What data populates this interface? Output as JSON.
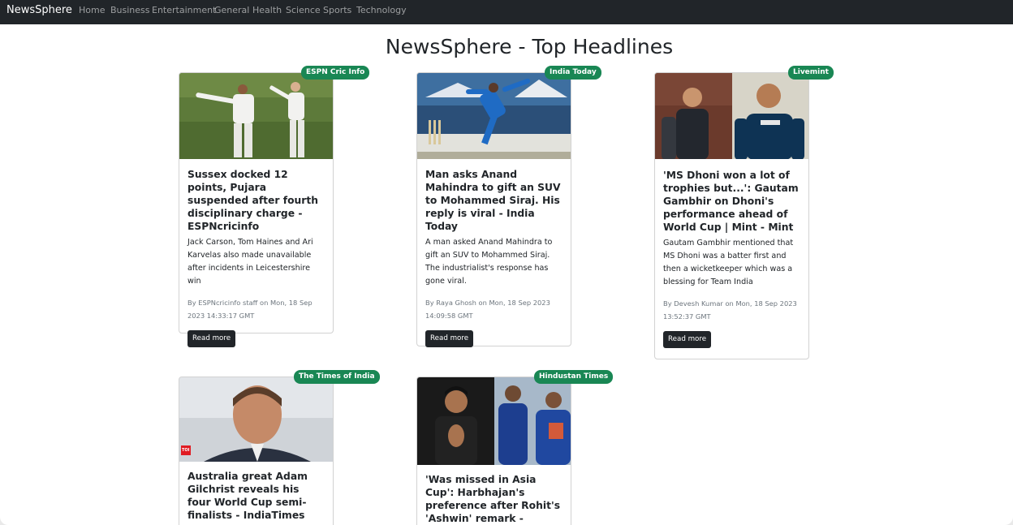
{
  "navbar": {
    "brand": "NewsSphere",
    "links": [
      "Home",
      "Business",
      "Entertainment",
      "General",
      "Health",
      "Science",
      "Sports",
      "Technology"
    ]
  },
  "page": {
    "title": "NewsSphere - Top Headlines"
  },
  "articles": [
    {
      "source": "ESPN Cric Info",
      "title": "Sussex docked 12 points, Pujara suspended after fourth disciplinary charge - ESPNcricinfo",
      "description": "Jack Carson, Tom Haines and Ari Karvelas also made unavailable after incidents in Leicestershire win",
      "meta": "By ESPNcricinfo staff on Mon, 18 Sep 2023 14:33:17 GMT",
      "read_more": "Read more"
    },
    {
      "source": "India Today",
      "title": "Man asks Anand Mahindra to gift an SUV to Mohammed Siraj. His reply is viral - India Today",
      "description": "A man asked Anand Mahindra to gift an SUV to Mohammed Siraj. The industrialist's response has gone viral.",
      "meta": "By Raya Ghosh on Mon, 18 Sep 2023 14:09:58 GMT",
      "read_more": "Read more"
    },
    {
      "source": "Livemint",
      "title": "'MS Dhoni won a lot of trophies but...': Gautam Gambhir on Dhoni's performance ahead of World Cup | Mint - Mint",
      "description": "Gautam Gambhir mentioned that MS Dhoni was a batter first and then a wicketkeeper which was a blessing for Team India",
      "meta": "By Devesh Kumar on Mon, 18 Sep 2023 13:52:37 GMT",
      "read_more": "Read more"
    },
    {
      "source": "The Times of India",
      "title": "Australia great Adam Gilchrist reveals his four World Cup semi-finalists - IndiaTimes",
      "image_badge": "TOI"
    },
    {
      "source": "Hindustan Times",
      "title": "'Was missed in Asia Cup': Harbhajan's preference after Rohit's 'Ashwin' remark - Hindustan Times"
    }
  ],
  "colors": {
    "navbar": "#212529",
    "badge": "#198754",
    "button": "#212529"
  }
}
